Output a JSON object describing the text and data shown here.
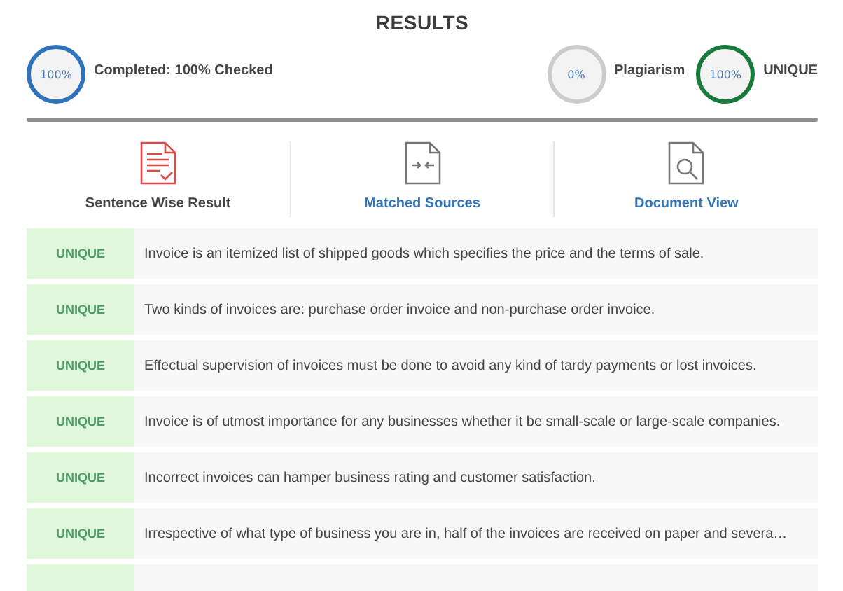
{
  "title": "RESULTS",
  "stats": [
    {
      "value": "100%",
      "label": "Completed: 100% Checked",
      "color": "#2f73bd"
    },
    {
      "value": "0%",
      "label": "Plagiarism",
      "color": "#cccccc"
    },
    {
      "value": "100%",
      "label": "UNIQUE",
      "color": "#17793a"
    }
  ],
  "tabs": [
    {
      "label": "Sentence Wise Result",
      "selected": true,
      "kind": "sentences"
    },
    {
      "label": "Matched Sources",
      "selected": false,
      "kind": "sources"
    },
    {
      "label": "Document View",
      "selected": false,
      "kind": "document"
    }
  ],
  "rows": [
    {
      "status": "UNIQUE",
      "text": "Invoice is an itemized list of shipped goods which specifies the price and the terms of sale."
    },
    {
      "status": "UNIQUE",
      "text": "Two kinds of invoices are: purchase order invoice and non-purchase order invoice."
    },
    {
      "status": "UNIQUE",
      "text": "Effectual supervision of invoices must be done to avoid any kind of tardy payments or lost invoices."
    },
    {
      "status": "UNIQUE",
      "text": "Invoice is of utmost importance for any businesses whether it be small-scale or large-scale companies."
    },
    {
      "status": "UNIQUE",
      "text": "Incorrect invoices can hamper business rating and customer satisfaction."
    },
    {
      "status": "UNIQUE",
      "text": "Irrespective of what type of business you are in, half of the invoices are received on paper and severa…"
    }
  ]
}
